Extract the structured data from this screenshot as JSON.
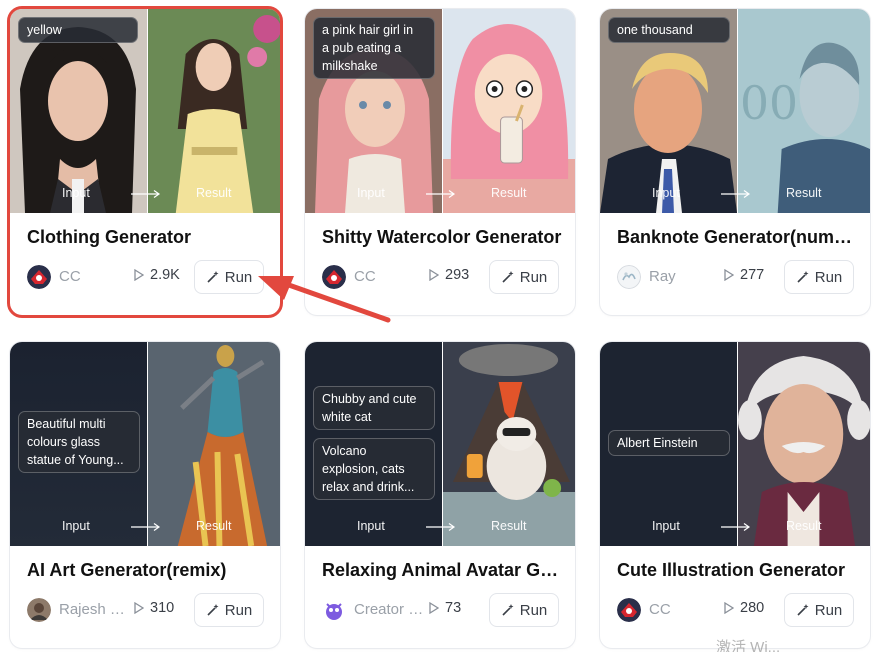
{
  "common": {
    "input_label": "Input",
    "result_label": "Result",
    "run_label": "Run"
  },
  "cards": [
    {
      "prompt_lines": [
        "yellow"
      ],
      "title": "Clothing Generator",
      "author": "CC",
      "runs": "2.9K"
    },
    {
      "prompt_lines": [
        "a pink hair girl in",
        "a pub eating a",
        "milkshake"
      ],
      "title": "Shitty Watercolor Generator",
      "author": "CC",
      "runs": "293"
    },
    {
      "prompt_lines": [
        "one thousand"
      ],
      "title": "Banknote Generator(number)",
      "author": "Ray",
      "runs": "277"
    },
    {
      "prompt_lines": [
        "Beautiful multi",
        "colours glass",
        "statue of Young..."
      ],
      "title": "AI Art Generator(remix)",
      "author": "Rajesh Kumar",
      "runs": "310"
    },
    {
      "prompt_lines": [
        "Chubby and cute",
        "white cat"
      ],
      "prompt2_lines": [
        "Volcano",
        "explosion, cats",
        "relax and drink..."
      ],
      "title": "Relaxing Animal Avatar Generator",
      "author": "Creator Studio",
      "runs": "73"
    },
    {
      "prompt_lines": [
        "Albert Einstein"
      ],
      "title": "Cute Illustration Generator",
      "author": "CC",
      "runs": "280"
    }
  ],
  "watermark": "激活 Wi..."
}
